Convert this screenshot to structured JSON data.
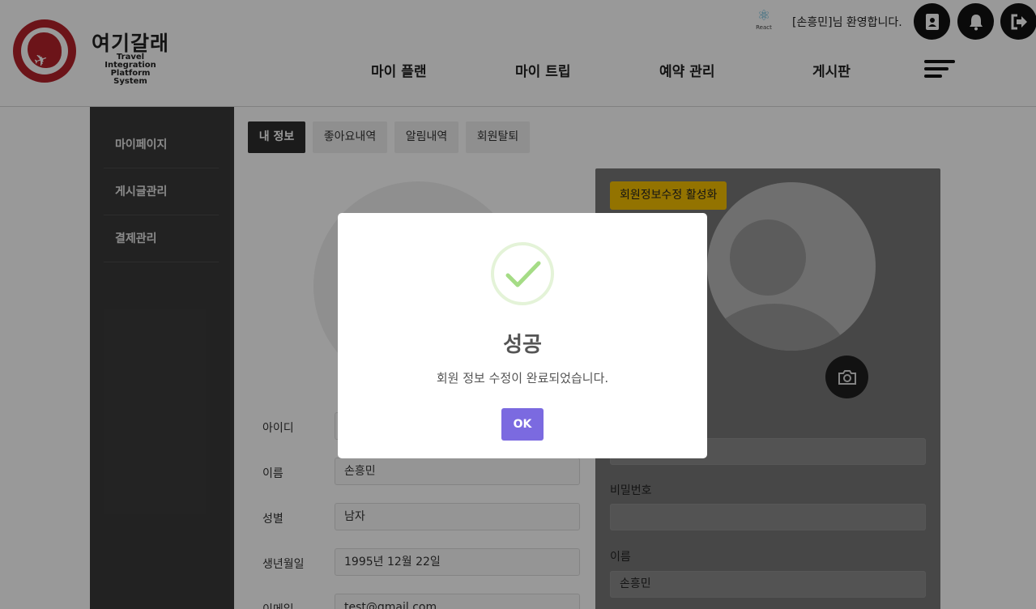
{
  "header": {
    "logo_title": "여기갈래",
    "logo_subtitle_line1": "Travel Integration",
    "logo_subtitle_line2": "Platform System",
    "react_label": "React",
    "welcome_text": "[손흥민]님 환영합니다.",
    "nav": [
      "마이 플랜",
      "마이 트립",
      "예약 관리",
      "게시판"
    ]
  },
  "sidebar": {
    "items": [
      {
        "label": "마이페이지"
      },
      {
        "label": "게시글관리"
      },
      {
        "label": "결제관리"
      }
    ]
  },
  "tabs": [
    {
      "label": "내 정보",
      "active": true
    },
    {
      "label": "좋아요내역",
      "active": false
    },
    {
      "label": "알림내역",
      "active": false
    },
    {
      "label": "회원탈퇴",
      "active": false
    }
  ],
  "profile_fields": [
    {
      "label": "아이디",
      "value": ""
    },
    {
      "label": "이름",
      "value": "손흥민"
    },
    {
      "label": "성별",
      "value": "남자"
    },
    {
      "label": "생년월일",
      "value": "1995년 12월 22일"
    },
    {
      "label": "이메일",
      "value": "test@gmail.com"
    }
  ],
  "edit_panel": {
    "toggle_label": "회원정보수정 활성화",
    "fields": [
      {
        "label": "",
        "value": ""
      },
      {
        "label": "비밀번호",
        "value": ""
      },
      {
        "label": "이름",
        "value": "손흥민"
      }
    ]
  },
  "modal": {
    "icon": "checkmark-icon",
    "title": "성공",
    "message": "회원 정보 수정이 완료되었습니다.",
    "ok_label": "OK"
  },
  "colors": {
    "brand_red": "#b5222a",
    "sidebar_bg": "#3a3a3a",
    "toggle_yellow": "#f5c000",
    "ok_button": "#7b6ae0",
    "success_green": "#a5dc86"
  }
}
